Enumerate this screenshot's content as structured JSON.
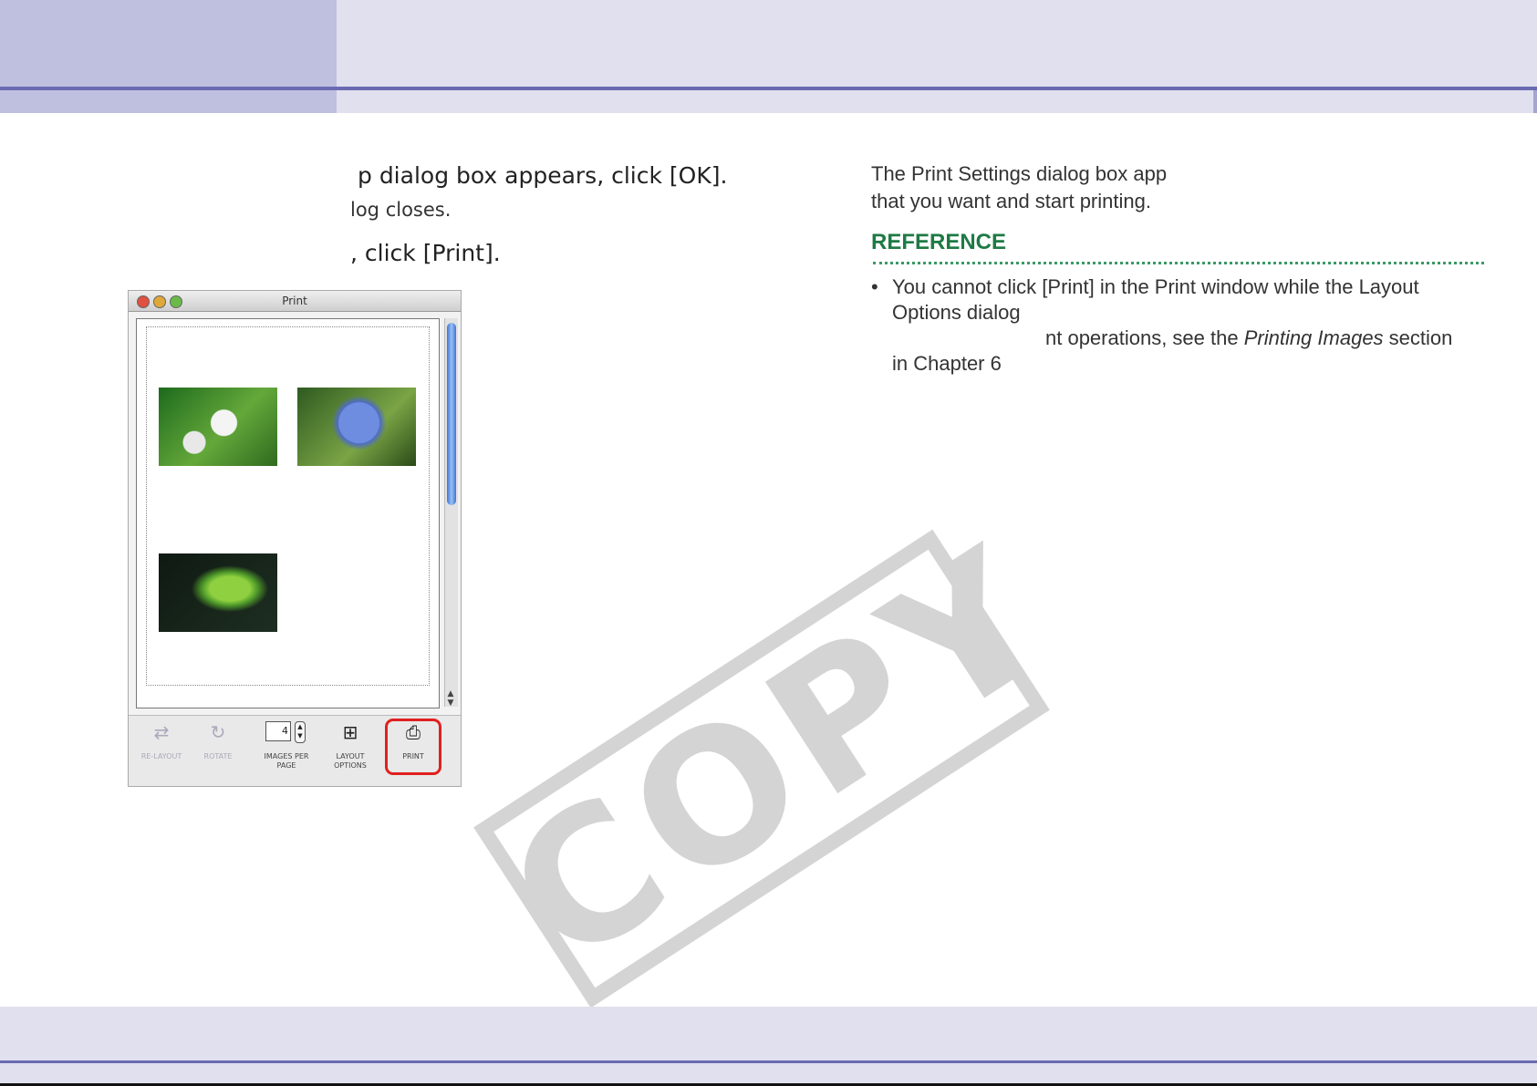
{
  "steps": {
    "step1_heading": "p dialog box appears, click [OK].",
    "step1_note": "log closes.",
    "step2_heading": ", click [Print]."
  },
  "right_column": {
    "line1": "The Print Settings dialog box app",
    "line2": "that you want and start printing.",
    "reference_label": "REFERENCE",
    "bullet1_line1": "You cannot click [Print] in the Print window while the Layout",
    "bullet1_line2": "Options dialog",
    "bullet2_prefix": "nt operations, see the ",
    "bullet2_italic": "Printing Images",
    "bullet2_suffix": " section",
    "bullet2_line2": "in Chapter 6"
  },
  "print_window": {
    "title": "Print",
    "images_per_page_value": "4",
    "toolbar": [
      {
        "label": "RE-LAYOUT",
        "icon": "relayout-icon",
        "enabled": false
      },
      {
        "label": "ROTATE",
        "icon": "rotate-icon",
        "enabled": false
      },
      {
        "label": "IMAGES PER PAGE",
        "icon": "images-per-page-icon",
        "enabled": true
      },
      {
        "label": "LAYOUT OPTIONS",
        "icon": "layout-options-icon",
        "enabled": true
      },
      {
        "label": "PRINT",
        "icon": "printer-icon",
        "enabled": true
      }
    ],
    "photos": [
      "white-hydrangea-photo",
      "blue-hydrangea-photo",
      "green-leaves-photo"
    ]
  },
  "watermark": "COPY",
  "colors": {
    "header_band": "#e0e0ee",
    "header_tab": "#bfc0e0",
    "rule": "#6a6ab2",
    "reference_green": "#1e7a44",
    "highlight_red": "#e02020",
    "watermark_gray": "#d4d4d4"
  }
}
